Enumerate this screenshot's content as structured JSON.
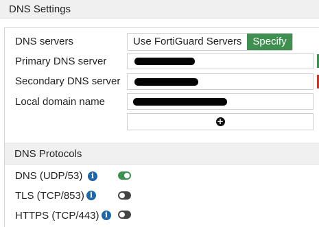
{
  "page": {
    "title": "DNS Settings"
  },
  "dns_servers": {
    "label": "DNS servers",
    "options": [
      "Use FortiGuard Servers",
      "Specify"
    ],
    "selected": "Specify"
  },
  "primary_dns": {
    "label": "Primary DNS server",
    "value_redacted": true,
    "status_color": "#3f8f50"
  },
  "secondary_dns": {
    "label": "Secondary DNS server",
    "value_redacted": true,
    "status_color": "#c0392b"
  },
  "local_domain": {
    "label": "Local domain name",
    "value_redacted": true
  },
  "add_button": {
    "icon": "plus-circle-icon"
  },
  "protocols": {
    "title": "DNS Protocols",
    "items": [
      {
        "label": "DNS (UDP/53)",
        "enabled": true
      },
      {
        "label": "TLS (TCP/853)",
        "enabled": false
      },
      {
        "label": "HTTPS (TCP/443)",
        "enabled": false
      }
    ]
  },
  "colors": {
    "accent": "#3f8f50",
    "info": "#1f67a6"
  }
}
